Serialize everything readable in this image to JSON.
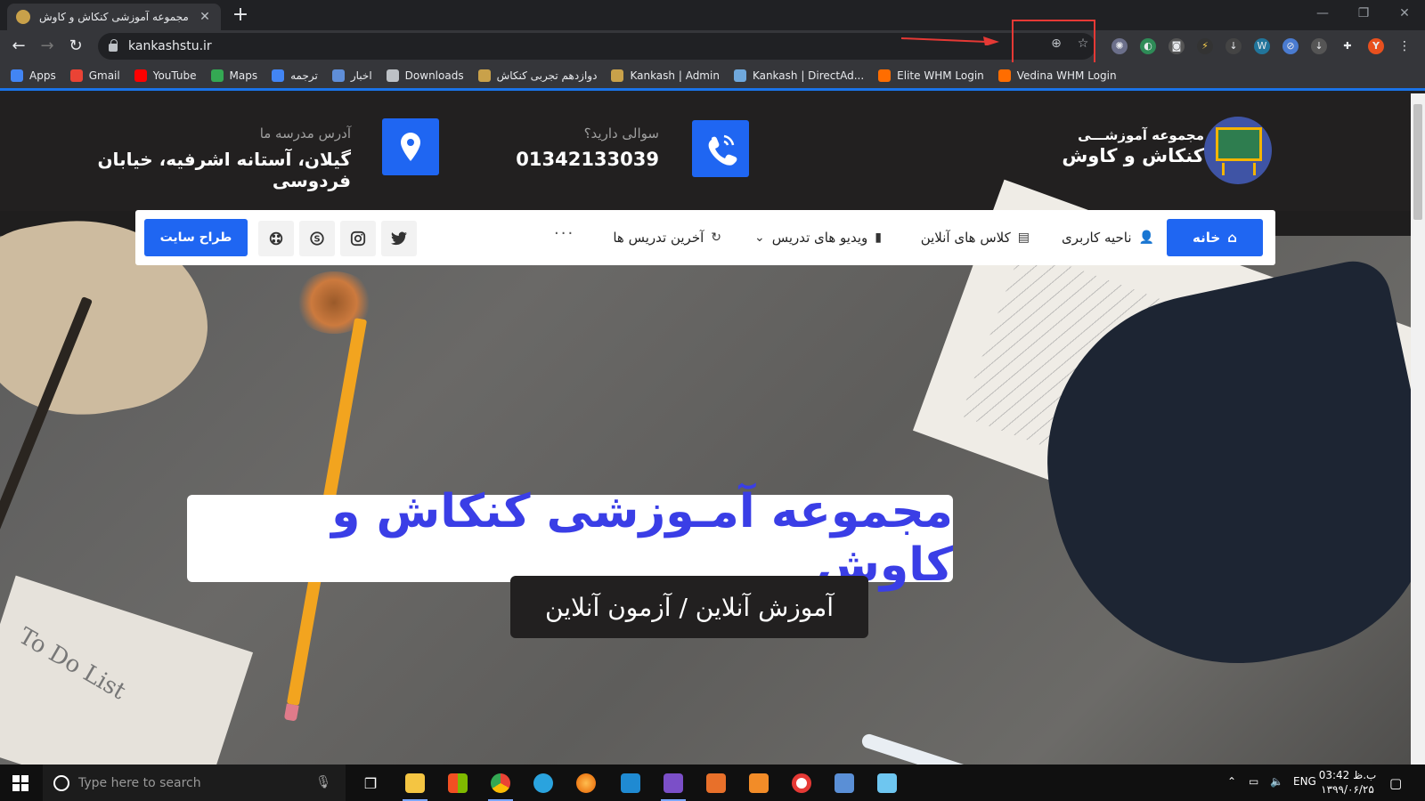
{
  "browser": {
    "tab_title": "مجموعه آموزشی کنکاش و کاوش",
    "tab_close": "✕",
    "new_tab": "+",
    "url": "kankashstu.ir",
    "bookmarks": [
      {
        "label": "Apps",
        "color": "#4285f4"
      },
      {
        "label": "Gmail",
        "color": "#ea4335"
      },
      {
        "label": "YouTube",
        "color": "#ff0000"
      },
      {
        "label": "Maps",
        "color": "#34a853"
      },
      {
        "label": "ترجمه",
        "color": "#4285f4"
      },
      {
        "label": "اخبار",
        "color": "#5f8ed8"
      },
      {
        "label": "Downloads",
        "color": "#bdc1c6"
      },
      {
        "label": "دوازدهم تجربی کنکاش",
        "color": "#c9a14a"
      },
      {
        "label": "Kankash | Admin",
        "color": "#c9a14a"
      },
      {
        "label": "Kankash | DirectAd...",
        "color": "#6fa8dc"
      },
      {
        "label": "Elite WHM Login",
        "color": "#ff6d00"
      },
      {
        "label": "Vedina WHM Login",
        "color": "#ff6d00"
      }
    ],
    "profile_initial": "Y"
  },
  "site": {
    "logo_line1": "مجموعه آموزشـــی",
    "logo_line2": "کنکاش و کاوش",
    "phone_label": "سوالی دارید؟",
    "phone_value": "01342133039",
    "address_label": "آدرس مدرسه ما",
    "address_value": "گیلان، آستانه اشرفیه، خیابان فردوسی",
    "nav": {
      "home": "خانه",
      "user_area": "ناحیه کاربری",
      "online_classes": "کلاس های آنلاین",
      "teaching_videos": "ویدیو های تدریس",
      "latest_teachings": "آخرین تدریس ها",
      "more": "···",
      "designer": "طراح سایت"
    },
    "hero_title": "مجموعه آمـوزشی کنکاش و کاوش",
    "hero_subtitle": "آموزش آنلاین / آزمون آنلاین",
    "hero_paper_text": "To Do List"
  },
  "taskbar": {
    "search_placeholder": "Type here to search",
    "language": "ENG",
    "time": "03:42 ب.ظ",
    "date": "۱۳۹۹/۰۶/۲۵"
  },
  "colors": {
    "accent_blue": "#1f66f2",
    "hero_title": "#3a3ee6",
    "annotation_red": "#e53935"
  }
}
